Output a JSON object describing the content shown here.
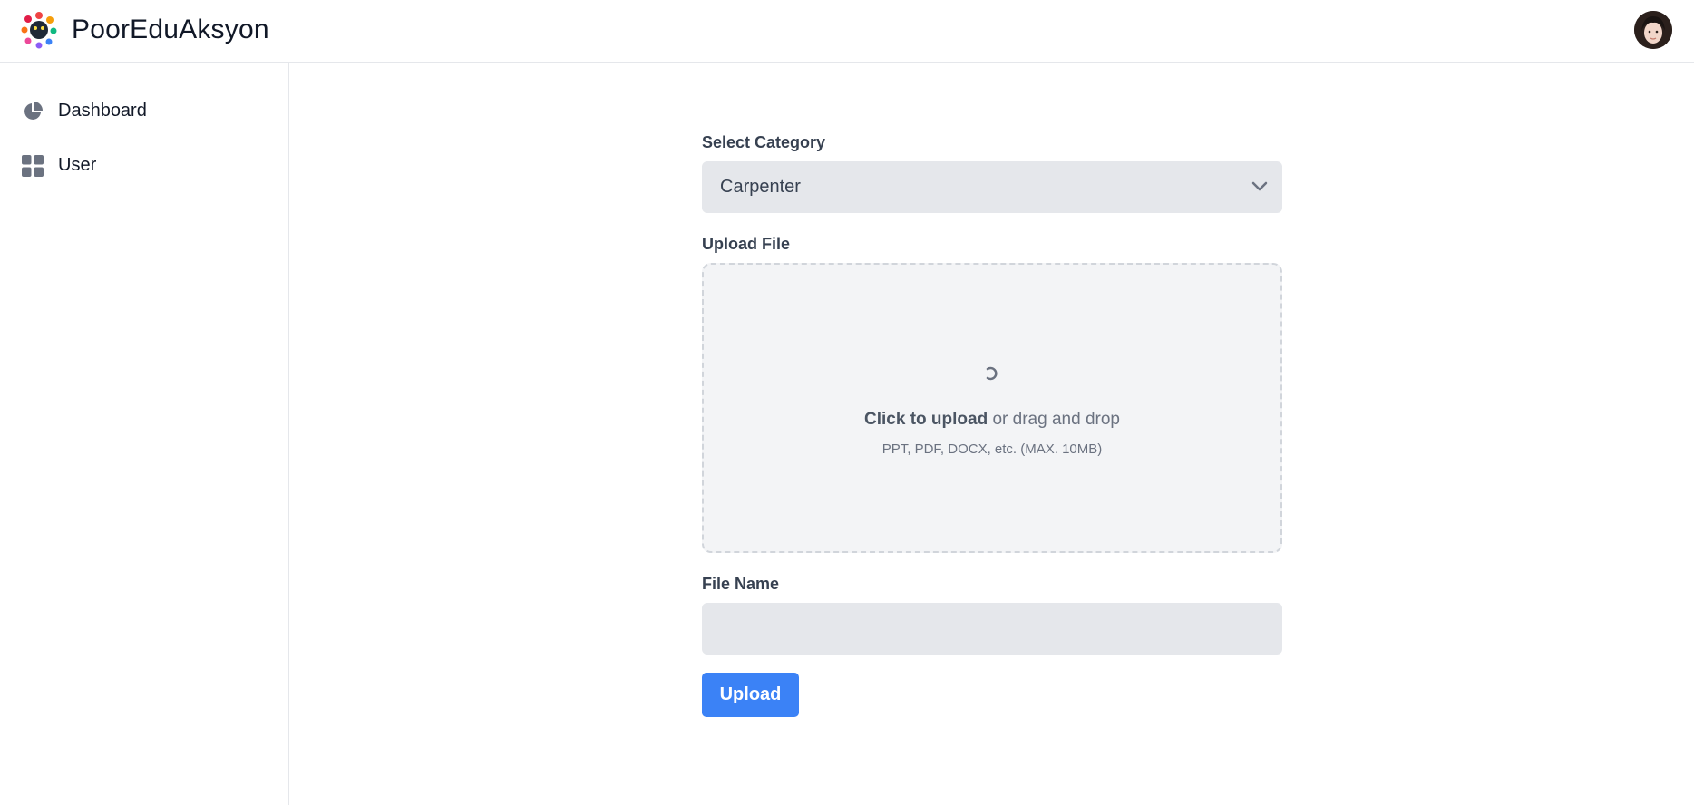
{
  "header": {
    "brand": "PoorEduAksyon",
    "logo_icon": "logo-icon",
    "avatar_icon": "user-avatar"
  },
  "sidebar": {
    "items": [
      {
        "label": "Dashboard",
        "icon": "pie-chart-icon"
      },
      {
        "label": "User",
        "icon": "grid-icon"
      }
    ]
  },
  "form": {
    "category_label": "Select Category",
    "category_value": "Carpenter",
    "upload_label": "Upload File",
    "dropzone": {
      "click_text": "Click to upload",
      "drag_text": " or drag and drop",
      "hint": "PPT, PDF, DOCX, etc. (MAX. 10MB)"
    },
    "filename_label": "File Name",
    "filename_value": "",
    "filename_placeholder": "",
    "submit_label": "Upload"
  },
  "colors": {
    "accent": "#3b82f6",
    "field_bg": "#e5e7eb",
    "dropzone_bg": "#f3f4f6"
  }
}
